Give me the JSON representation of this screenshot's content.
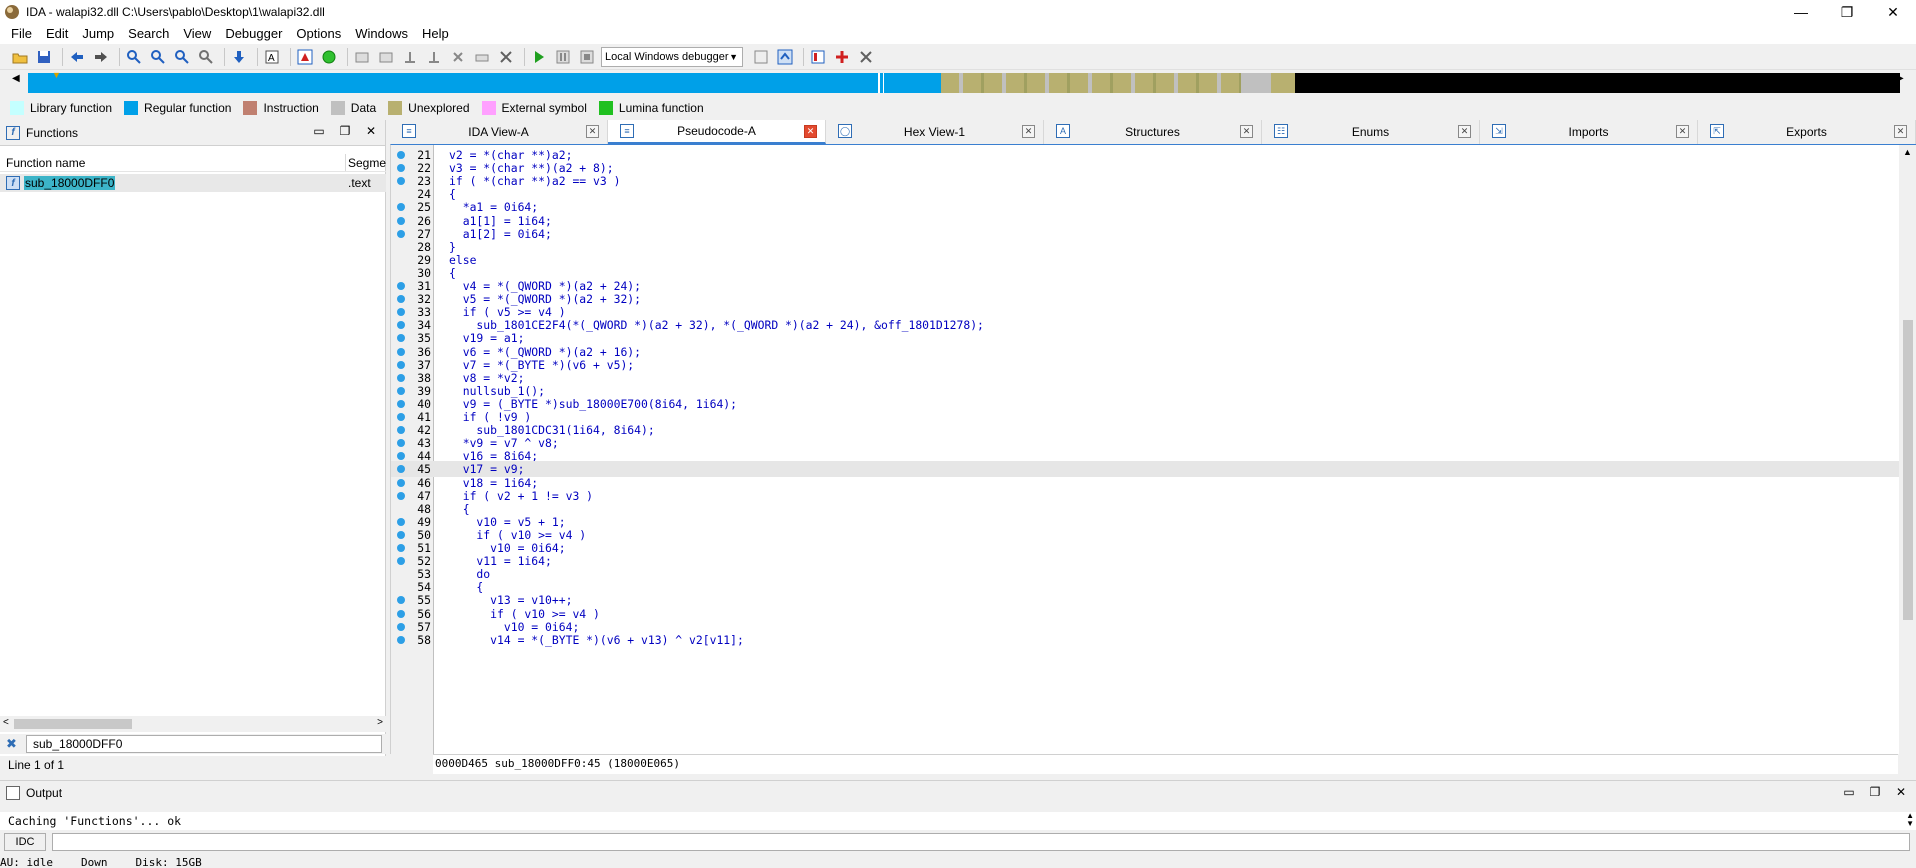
{
  "window": {
    "title": "IDA - walapi32.dll C:\\Users\\pablo\\Desktop\\1\\walapi32.dll",
    "minimize": "—",
    "restore": "❐",
    "close": "✕"
  },
  "menu": [
    "File",
    "Edit",
    "Jump",
    "Search",
    "View",
    "Debugger",
    "Options",
    "Windows",
    "Help"
  ],
  "toolbar": {
    "debugger_label": "Local Windows debugger"
  },
  "legend": [
    {
      "label": "Library function",
      "color": "#c4ffff"
    },
    {
      "label": "Regular function",
      "color": "#00a0e8"
    },
    {
      "label": "Instruction",
      "color": "#c08070"
    },
    {
      "label": "Data",
      "color": "#c0c0c0"
    },
    {
      "label": "Unexplored",
      "color": "#b8b070"
    },
    {
      "label": "External symbol",
      "color": "#ffa0ff"
    },
    {
      "label": "Lumina function",
      "color": "#20c020"
    }
  ],
  "functions_panel": {
    "title": "Functions",
    "col_name": "Function name",
    "col_segment": "Segme",
    "rows": [
      {
        "name": "sub_18000DFF0",
        "segment": ".text"
      }
    ],
    "filter_value": "sub_18000DFF0",
    "status": "Line 1 of 1"
  },
  "tabs": [
    {
      "label": "IDA View-A",
      "icon": "disasm-icon",
      "active": false
    },
    {
      "label": "Pseudocode-A",
      "icon": "pseudocode-icon",
      "active": true
    },
    {
      "label": "Hex View-1",
      "icon": "hex-icon",
      "active": false
    },
    {
      "label": "Structures",
      "icon": "struct-icon",
      "active": false
    },
    {
      "label": "Enums",
      "icon": "enum-icon",
      "active": false
    },
    {
      "label": "Imports",
      "icon": "imports-icon",
      "active": false
    },
    {
      "label": "Exports",
      "icon": "exports-icon",
      "active": false
    }
  ],
  "code": {
    "highlight_line": 45,
    "lines": [
      {
        "n": "21",
        "dot": true,
        "text": "v2 = *(char **)a2;"
      },
      {
        "n": "22",
        "dot": true,
        "text": "v3 = *(char **)(a2 + 8);"
      },
      {
        "n": "23",
        "dot": true,
        "text": "if ( *(char **)a2 == v3 )"
      },
      {
        "n": "24",
        "dot": false,
        "text": "{"
      },
      {
        "n": "25",
        "dot": true,
        "text": "  *a1 = 0i64;"
      },
      {
        "n": "26",
        "dot": true,
        "text": "  a1[1] = 1i64;"
      },
      {
        "n": "27",
        "dot": true,
        "text": "  a1[2] = 0i64;"
      },
      {
        "n": "28",
        "dot": false,
        "text": "}"
      },
      {
        "n": "29",
        "dot": false,
        "text": "else"
      },
      {
        "n": "30",
        "dot": false,
        "text": "{"
      },
      {
        "n": "31",
        "dot": true,
        "text": "  v4 = *(_QWORD *)(a2 + 24);"
      },
      {
        "n": "32",
        "dot": true,
        "text": "  v5 = *(_QWORD *)(a2 + 32);"
      },
      {
        "n": "33",
        "dot": true,
        "text": "  if ( v5 >= v4 )"
      },
      {
        "n": "34",
        "dot": true,
        "text": "    sub_1801CE2F4(*(_QWORD *)(a2 + 32), *(_QWORD *)(a2 + 24), &off_1801D1278);"
      },
      {
        "n": "35",
        "dot": true,
        "text": "  v19 = a1;"
      },
      {
        "n": "36",
        "dot": true,
        "text": "  v6 = *(_QWORD *)(a2 + 16);"
      },
      {
        "n": "37",
        "dot": true,
        "text": "  v7 = *(_BYTE *)(v6 + v5);"
      },
      {
        "n": "38",
        "dot": true,
        "text": "  v8 = *v2;"
      },
      {
        "n": "39",
        "dot": true,
        "text": "  nullsub_1();"
      },
      {
        "n": "40",
        "dot": true,
        "text": "  v9 = (_BYTE *)sub_18000E700(8i64, 1i64);"
      },
      {
        "n": "41",
        "dot": true,
        "text": "  if ( !v9 )"
      },
      {
        "n": "42",
        "dot": true,
        "text": "    sub_1801CDC31(1i64, 8i64);"
      },
      {
        "n": "43",
        "dot": true,
        "text": "  *v9 = v7 ^ v8;"
      },
      {
        "n": "44",
        "dot": true,
        "text": "  v16 = 8i64;"
      },
      {
        "n": "45",
        "dot": true,
        "text": "  v17 = v9;"
      },
      {
        "n": "46",
        "dot": true,
        "text": "  v18 = 1i64;"
      },
      {
        "n": "47",
        "dot": true,
        "text": "  if ( v2 + 1 != v3 )"
      },
      {
        "n": "48",
        "dot": false,
        "text": "  {"
      },
      {
        "n": "49",
        "dot": true,
        "text": "    v10 = v5 + 1;"
      },
      {
        "n": "50",
        "dot": true,
        "text": "    if ( v10 >= v4 )"
      },
      {
        "n": "51",
        "dot": true,
        "text": "      v10 = 0i64;"
      },
      {
        "n": "52",
        "dot": true,
        "text": "    v11 = 1i64;"
      },
      {
        "n": "53",
        "dot": false,
        "text": "    do"
      },
      {
        "n": "54",
        "dot": false,
        "text": "    {"
      },
      {
        "n": "55",
        "dot": true,
        "text": "      v13 = v10++;"
      },
      {
        "n": "56",
        "dot": true,
        "text": "      if ( v10 >= v4 )"
      },
      {
        "n": "57",
        "dot": true,
        "text": "        v10 = 0i64;"
      },
      {
        "n": "58",
        "dot": true,
        "text": "      v14 = *(_BYTE *)(v6 + v13) ^ v2[v11];"
      }
    ],
    "footer": "0000D465 sub_18000DFF0:45 (18000E065)"
  },
  "output": {
    "title": "Output",
    "message": "Caching 'Functions'... ok",
    "idc_label": "IDC",
    "status": [
      "AU:  idle",
      "Down",
      "Disk: 15GB"
    ]
  }
}
